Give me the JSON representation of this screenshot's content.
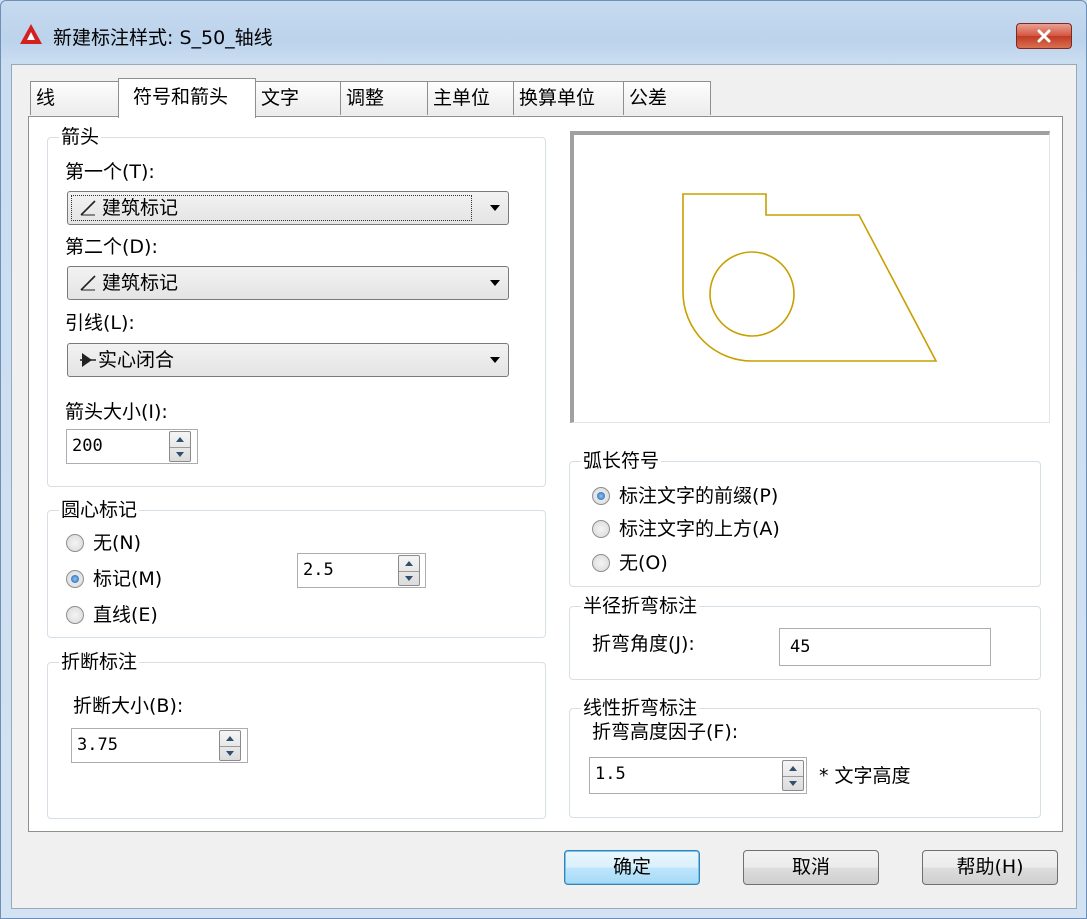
{
  "window": {
    "title": "新建标注样式: S_50_轴线"
  },
  "tabs": [
    {
      "label": "线"
    },
    {
      "label": "符号和箭头"
    },
    {
      "label": "文字"
    },
    {
      "label": "调整"
    },
    {
      "label": "主单位"
    },
    {
      "label": "换算单位"
    },
    {
      "label": "公差"
    }
  ],
  "arrowheads": {
    "title": "箭头",
    "first_label": "第一个(T):",
    "first_value": "建筑标记",
    "second_label": "第二个(D):",
    "second_value": "建筑标记",
    "leader_label": "引线(L):",
    "leader_value": "实心闭合",
    "size_label": "箭头大小(I):",
    "size_value": "200"
  },
  "center_marks": {
    "title": "圆心标记",
    "options": [
      "无(N)",
      "标记(M)",
      "直线(E)"
    ],
    "selected": "标记(M)",
    "size_value": "2.5"
  },
  "dimension_break": {
    "title": "折断标注",
    "size_label": "折断大小(B):",
    "size_value": "3.75"
  },
  "arc_length": {
    "title": "弧长符号",
    "options": [
      "标注文字的前缀(P)",
      "标注文字的上方(A)",
      "无(O)"
    ],
    "selected": "标注文字的前缀(P)"
  },
  "radius_jog": {
    "title": "半径折弯标注",
    "angle_label": "折弯角度(J):",
    "angle_value": "45"
  },
  "linear_jog": {
    "title": "线性折弯标注",
    "factor_label": "折弯高度因子(F):",
    "factor_value": "1.5",
    "suffix": "* 文字高度"
  },
  "buttons": {
    "ok": "确定",
    "cancel": "取消",
    "help": "帮助(H)"
  },
  "colors": {
    "preview_stroke": "#c8a000",
    "close_red": "#c9432c"
  },
  "icons": {
    "architectural_tick": "tick-icon",
    "closed_filled": "closed-filled-arrow-icon",
    "app": "autocad-logo-icon"
  }
}
